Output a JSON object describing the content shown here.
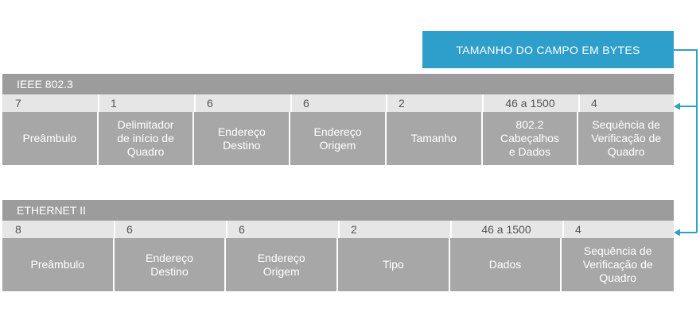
{
  "legend": "TAMANHO DO CAMPO EM BYTES",
  "colors": {
    "accent": "#2e9fcb",
    "header_gray": "#9c9c9c",
    "field_gray": "#a7a7a7",
    "size_row": "#e6e6e6"
  },
  "frames": [
    {
      "title": "IEEE  802.3",
      "fields": [
        {
          "size": "7",
          "label": "Preâmbulo"
        },
        {
          "size": "1",
          "label": "Delimitador\nde início de\nQuadro"
        },
        {
          "size": "6",
          "label": "Endereço\nDestino"
        },
        {
          "size": "6",
          "label": "Endereço\nOrigem"
        },
        {
          "size": "2",
          "label": "Tamanho"
        },
        {
          "size": "46 a 1500",
          "label": "802.2\nCabeçalhos\ne Dados"
        },
        {
          "size": "4",
          "label": "Sequência de\nVerificação de\nQuadro"
        }
      ]
    },
    {
      "title": "ETHERNET II",
      "fields": [
        {
          "size": "8",
          "label": "Preâmbulo"
        },
        {
          "size": "6",
          "label": "Endereço\nDestino"
        },
        {
          "size": "6",
          "label": "Endereço\nOrigem"
        },
        {
          "size": "2",
          "label": "Tipo"
        },
        {
          "size": "46 a 1500",
          "label": "Dados"
        },
        {
          "size": "4",
          "label": "Sequência de\nVerificação de\nQuadro"
        }
      ]
    }
  ]
}
